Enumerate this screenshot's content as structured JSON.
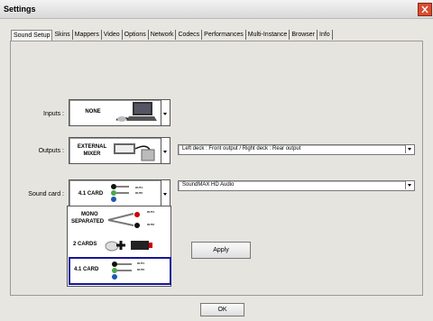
{
  "window": {
    "title": "Settings"
  },
  "tabs": [
    {
      "label": "Sound Setup",
      "active": true
    },
    {
      "label": "Skins"
    },
    {
      "label": "Mappers"
    },
    {
      "label": "Video"
    },
    {
      "label": "Options"
    },
    {
      "label": "Network"
    },
    {
      "label": "Codecs"
    },
    {
      "label": "Performances"
    },
    {
      "label": "Multi-Instance"
    },
    {
      "label": "Browser"
    },
    {
      "label": "Info"
    }
  ],
  "sound_setup": {
    "inputs": {
      "label": "Inputs :",
      "value": "NONE"
    },
    "outputs": {
      "label": "Outputs :",
      "value_line1": "EXTERNAL",
      "value_line2": "MIXER",
      "routing": "Left deck : Front output / Right deck : Rear output"
    },
    "sound_card": {
      "label": "Sound card :",
      "value": "4.1 CARD",
      "device": "SoundMAX HD Audio"
    },
    "dropdown_options": [
      {
        "line1": "MONO",
        "line2": "SEPARATED"
      },
      {
        "line1": "2 CARDS"
      },
      {
        "line1": "4.1 CARD",
        "selected": true
      }
    ],
    "apply_label": "Apply",
    "ok_label": "OK",
    "port_labels": {
      "out1": "OUT1",
      "out2": "OUT2"
    }
  },
  "colors": {
    "selection_border": "#151599",
    "close_button": "#d94c30"
  }
}
